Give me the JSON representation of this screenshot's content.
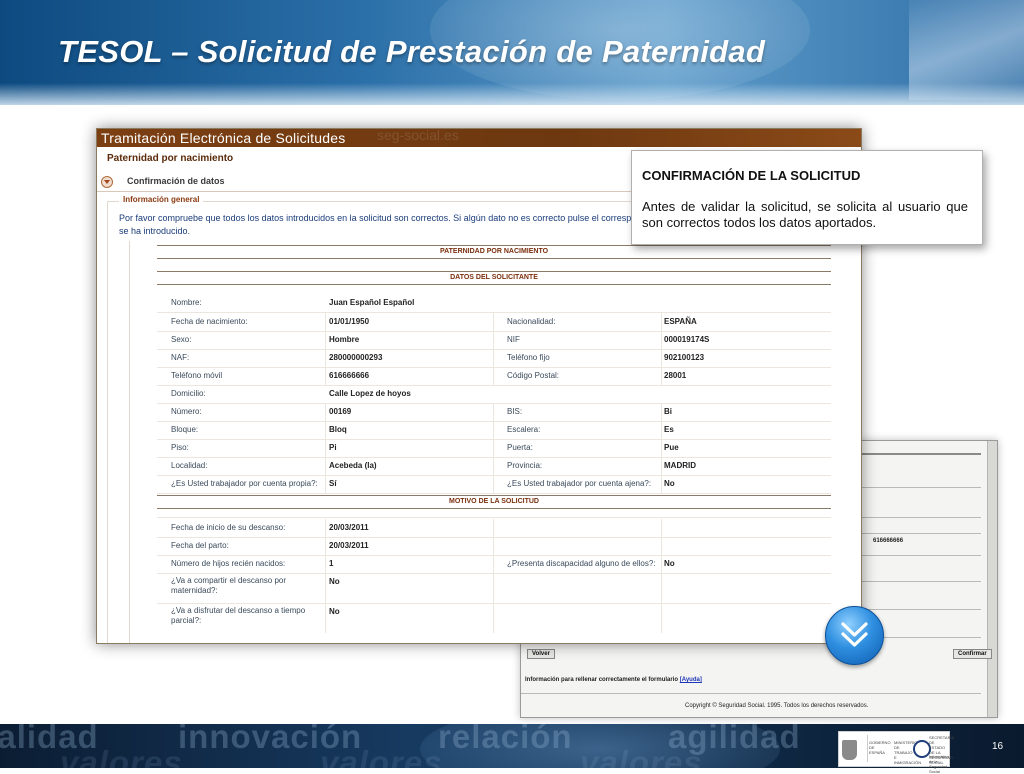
{
  "slide": {
    "title": "TESOL – Solicitud de Prestación de Paternidad",
    "page_number": "16"
  },
  "front": {
    "header": "Tramitación Electrónica de Solicitudes",
    "header_ghost": "seg-social.es",
    "procedure_title": "Paternidad por nacimiento",
    "section_label": "Confirmación de datos",
    "legend": "Información general",
    "intro": "Por favor compruebe que todos los datos introducidos en la solicitud son correctos. Si algún dato no es correcto pulse el corresponda. A continuación se muestra toda la información que se ha introducido.",
    "band_1": "PATERNIDAD POR NACIMIENTO",
    "band_2": "DATOS DEL SOLICITANTE",
    "band_3": "MOTIVO DE LA SOLICITUD",
    "applicant": {
      "nombre_label": "Nombre:",
      "nombre": "Juan Español Español",
      "fecha_nac_label": "Fecha de nacimiento:",
      "fecha_nac": "01/01/1950",
      "nacionalidad_label": "Nacionalidad:",
      "nacionalidad": "ESPAÑA",
      "sexo_label": "Sexo:",
      "sexo": "Hombre",
      "nif_label": "NIF",
      "nif": "000019174S",
      "naf_label": "NAF:",
      "naf": "280000000293",
      "tel_fijo_label": "Teléfono fijo",
      "tel_fijo": "902100123",
      "tel_movil_label": "Teléfono móvil",
      "tel_movil": "616666666",
      "cp_label": "Código Postal:",
      "cp": "28001",
      "domicilio_label": "Domicilio:",
      "domicilio": "Calle Lopez de hoyos",
      "numero_label": "Número:",
      "numero": "00169",
      "bis_label": "BIS:",
      "bis": "Bi",
      "bloque_label": "Bloque:",
      "bloque": "Bloq",
      "escalera_label": "Escalera:",
      "escalera": "Es",
      "piso_label": "Piso:",
      "piso": "Pi",
      "puerta_label": "Puerta:",
      "puerta": "Pue",
      "localidad_label": "Localidad:",
      "localidad": "Acebeda (la)",
      "provincia_label": "Provincia:",
      "provincia": "MADRID",
      "cuenta_propia_label": "¿Es Usted trabajador por cuenta propia?:",
      "cuenta_propia": "Sí",
      "cuenta_ajena_label": "¿Es Usted trabajador por cuenta ajena?:",
      "cuenta_ajena": "No"
    },
    "motive": {
      "inicio_label": "Fecha de inicio de su descanso:",
      "inicio": "20/03/2011",
      "parto_label": "Fecha del parto:",
      "parto": "20/03/2011",
      "hijos_label": "Número de hijos recién nacidos:",
      "hijos": "1",
      "discapacidad_label": "¿Presenta discapacidad alguno de ellos?:",
      "discapacidad": "No",
      "compartir_label": "¿Va a compartir el descanso por maternidad?:",
      "compartir": "No",
      "tiempo_parcial_label": "¿Va a disfrutar del descanso a tiempo parcial?:",
      "tiempo_parcial": "No"
    }
  },
  "back": {
    "phone_value": "616666666",
    "back_button": "Volver",
    "confirm_button": "Confirmar",
    "help_text": "Información para rellenar correctamente el formulario",
    "help_link": "[Ayuda]",
    "copyright": "Copyright © Seguridad Social. 1995. Todos los derechos reservados."
  },
  "callout": {
    "title": "CONFIRMACIÓN DE LA SOLICITUD",
    "body": "Antes de validar la solicitud, se solicita al usuario que son correctos todos los datos aportados."
  },
  "footer": {
    "words_top": [
      "calidad",
      "innovación",
      "relación",
      "agilidad"
    ],
    "words_bottom": [
      "valores",
      "valores",
      "valores"
    ],
    "logo_1_text": "GOBIERNO DE ESPAÑA",
    "logo_2_text": "MINISTERIO DE TRABAJO E INMIGRACIÓN",
    "logo_3_text": "SECRETARÍA DE ESTADO DE LA SEGURIDAD SOCIAL",
    "logo_4_text": "Informática de la Seguridad Social"
  },
  "colors": {
    "banner_blue": "#2b6fa8",
    "header_brown": "#7c3f12",
    "button_blue": "#2f8fe0"
  },
  "icons": {
    "next": "double-chevron-down-icon",
    "section_toggle": "caret-down-icon"
  }
}
